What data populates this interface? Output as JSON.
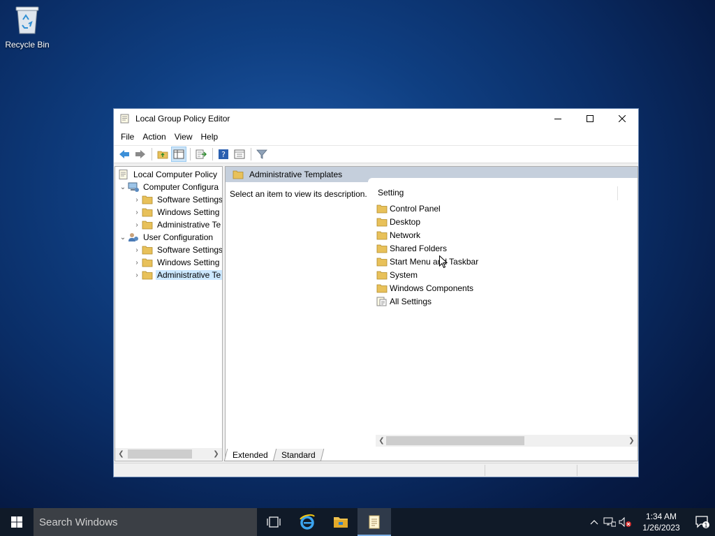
{
  "desktop": {
    "recycle_bin_label": "Recycle Bin"
  },
  "window": {
    "title": "Local Group Policy Editor",
    "menu": [
      "File",
      "Action",
      "Help",
      "View"
    ],
    "menu_items": {
      "file": "File",
      "action": "Action",
      "view": "View",
      "help": "Help"
    }
  },
  "tree": {
    "root": "Local Computer Policy",
    "computer_config": "Computer Configura",
    "cc_software": "Software Settings",
    "cc_windows": "Windows Setting",
    "cc_admin": "Administrative Te",
    "user_config": "User Configuration",
    "uc_software": "Software Settings",
    "uc_windows": "Windows Setting",
    "uc_admin": "Administrative Te"
  },
  "right_pane": {
    "header": "Administrative Templates",
    "description": "Select an item to view its description.",
    "column_header": "Setting",
    "items": [
      {
        "label": "Control Panel",
        "icon": "folder-icon"
      },
      {
        "label": "Desktop",
        "icon": "folder-icon"
      },
      {
        "label": "Network",
        "icon": "folder-icon"
      },
      {
        "label": "Shared Folders",
        "icon": "folder-icon"
      },
      {
        "label": "Start Menu and Taskbar",
        "icon": "folder-icon"
      },
      {
        "label": "System",
        "icon": "folder-icon"
      },
      {
        "label": "Windows Components",
        "icon": "folder-icon"
      },
      {
        "label": "All Settings",
        "icon": "all-settings-icon"
      }
    ]
  },
  "tabs": {
    "extended": "Extended",
    "standard": "Standard"
  },
  "taskbar": {
    "search_placeholder": "Search Windows",
    "time": "1:34 AM",
    "date": "1/26/2023",
    "notification_count": "1"
  },
  "colors": {
    "selection": "#cce8ff",
    "folder": "#e8c15a",
    "header_bar": "#c5cfdc",
    "taskbar": "#101a28"
  }
}
